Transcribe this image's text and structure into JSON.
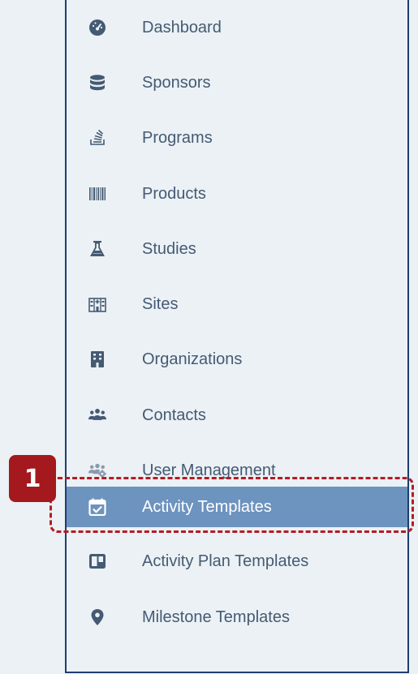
{
  "nav": {
    "items": [
      {
        "label": "Dashboard",
        "icon": "dashboard-gauge-icon"
      },
      {
        "label": "Sponsors",
        "icon": "database-icon"
      },
      {
        "label": "Programs",
        "icon": "stacked-layers-icon"
      },
      {
        "label": "Products",
        "icon": "barcode-icon"
      },
      {
        "label": "Studies",
        "icon": "flask-icon"
      },
      {
        "label": "Sites",
        "icon": "hospital-building-icon"
      },
      {
        "label": "Organizations",
        "icon": "building-icon"
      },
      {
        "label": "Contacts",
        "icon": "users-group-icon"
      },
      {
        "label": "User Management",
        "icon": "users-cog-icon"
      },
      {
        "label": "Activity Templates",
        "icon": "calendar-check-icon",
        "active": true
      },
      {
        "label": "Activity Plan Templates",
        "icon": "template-layout-icon"
      },
      {
        "label": "Milestone Templates",
        "icon": "map-marker-icon"
      }
    ]
  },
  "annotation": {
    "step_number": "1"
  },
  "colors": {
    "icon": "#455a73",
    "active_bg": "#6d93bf",
    "highlight": "#b31d24",
    "badge": "#a3191d",
    "frame": "#1f3e6e"
  }
}
